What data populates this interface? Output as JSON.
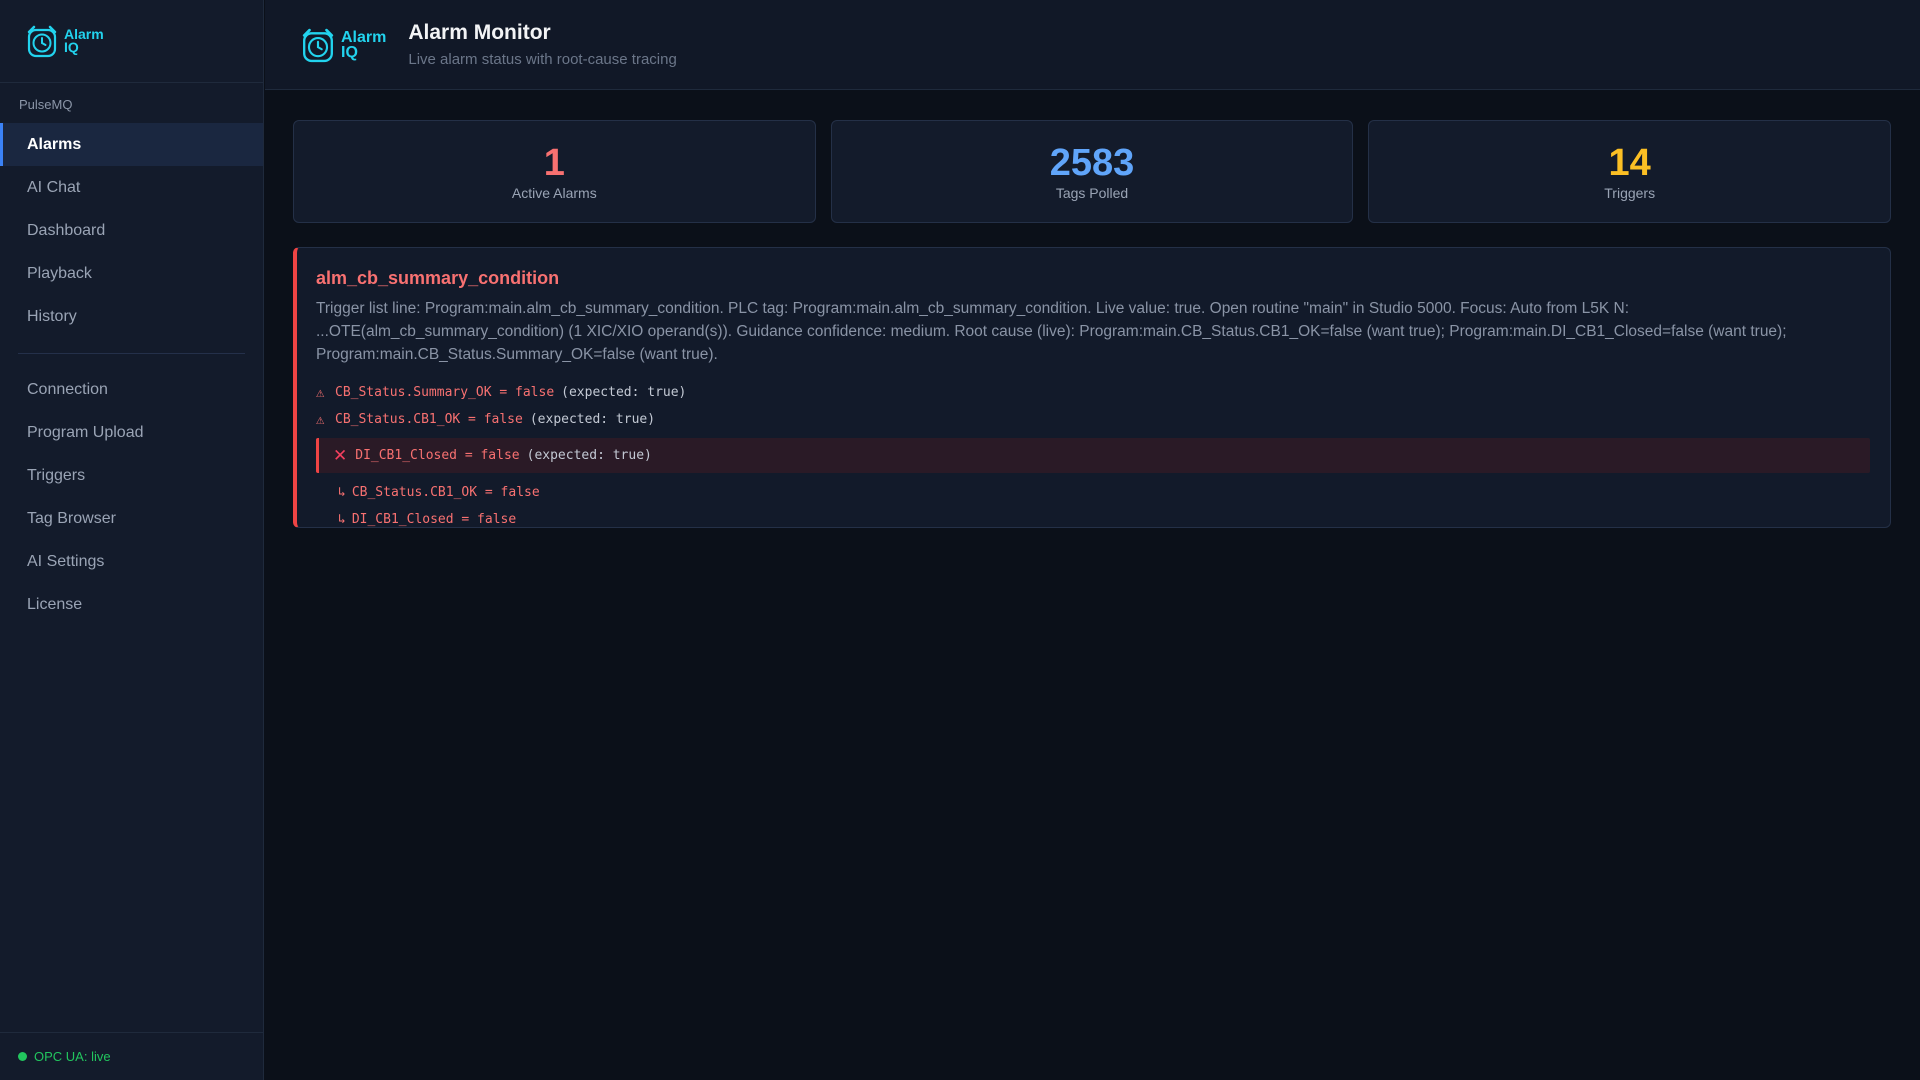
{
  "app": {
    "logo_text_line1": "Alarm",
    "logo_text_line2": "IQ",
    "org": "PulseMQ"
  },
  "sidebar": {
    "primary": [
      {
        "label": "Alarms",
        "active": true
      },
      {
        "label": "AI Chat"
      },
      {
        "label": "Dashboard"
      },
      {
        "label": "Playback"
      },
      {
        "label": "History"
      }
    ],
    "secondary": [
      {
        "label": "Connection"
      },
      {
        "label": "Program Upload"
      },
      {
        "label": "Triggers"
      },
      {
        "label": "Tag Browser"
      },
      {
        "label": "AI Settings"
      },
      {
        "label": "License"
      }
    ],
    "status": "OPC UA: live"
  },
  "header": {
    "title": "Alarm Monitor",
    "subtitle": "Live alarm status with root-cause tracing"
  },
  "stats": [
    {
      "value": "1",
      "label": "Active Alarms",
      "color": "#f87171"
    },
    {
      "value": "2583",
      "label": "Tags Polled",
      "color": "#60a5fa"
    },
    {
      "value": "14",
      "label": "Triggers",
      "color": "#fbbf24"
    }
  ],
  "alarm": {
    "name": "alm_cb_summary_condition",
    "description": "Trigger list line: Program:main.alm_cb_summary_condition. PLC tag: Program:main.alm_cb_summary_condition. Live value: true. Open routine \"main\" in Studio 5000. Focus: Auto from L5K N: ...OTE(alm_cb_summary_condition) (1 XIC/XIO operand(s)). Guidance confidence: medium. Root cause (live): Program:main.CB_Status.CB1_OK=false (want true); Program:main.DI_CB1_Closed=false (want true); Program:main.CB_Status.Summary_OK=false (want true).",
    "conditions": [
      {
        "expr": "CB_Status.Summary_OK = false",
        "expected": "(expected: true)",
        "icon": "⚠"
      },
      {
        "expr": "CB_Status.CB1_OK = false",
        "expected": "(expected: true)",
        "icon": "⚠"
      }
    ],
    "root": {
      "expr": "DI_CB1_Closed = false",
      "expected": "(expected: true)",
      "icon": "✕"
    },
    "children": [
      {
        "arrow": "↳",
        "expr": "CB_Status.CB1_OK = false"
      },
      {
        "arrow": "↳",
        "expr": "DI_CB1_Closed = false"
      }
    ]
  },
  "colors": {
    "accent": "#3b82f6",
    "brand": "#22d3ee",
    "alarm": "#ef4444",
    "live": "#22c55e"
  }
}
